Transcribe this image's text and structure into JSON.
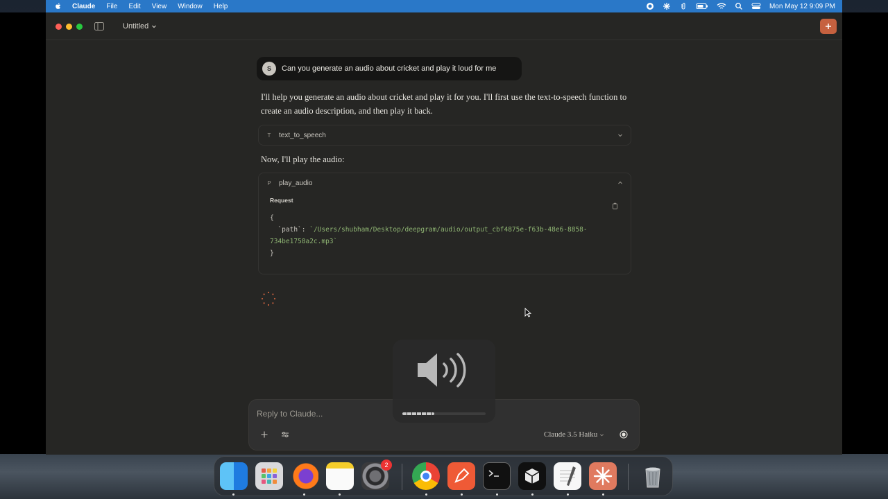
{
  "menubar": {
    "app": "Claude",
    "menus": [
      "File",
      "Edit",
      "View",
      "Window",
      "Help"
    ],
    "clock": "Mon May 12  9:09 PM"
  },
  "window": {
    "title": "Untitled"
  },
  "chat": {
    "user": {
      "initial": "S",
      "text": "Can you generate an audio about cricket and play it loud for me"
    },
    "assistant_intro": "I'll help you generate an audio about cricket and play it for you. I'll first use the text-to-speech function to create an audio description, and then play it back.",
    "tool1": {
      "letter": "T",
      "name": "text_to_speech",
      "expanded": false
    },
    "assistant_mid": "Now, I'll play the audio:",
    "tool2": {
      "letter": "P",
      "name": "play_audio",
      "expanded": true,
      "request_label": "Request",
      "code_open": "{",
      "code_key": "`path`",
      "code_colon": ": ",
      "code_value_line1": "`/Users/shubham/Desktop/deepgram/audio/output_cbf4875e-f63b-48e6-8858-",
      "code_value_line2": "734be1758a2c.mp3`",
      "code_close": "}"
    }
  },
  "composer": {
    "placeholder": "Reply to Claude...",
    "model": "Claude 3.5 Haiku"
  },
  "volume_hud": {
    "level": 0.38
  },
  "dock": {
    "apps": [
      "finder",
      "launchpad",
      "firefox",
      "notes",
      "system-settings",
      "chrome",
      "pen-app",
      "terminal",
      "cube-app",
      "textedit",
      "claude",
      "trash"
    ],
    "settings_badge": "2"
  },
  "colors": {
    "accent": "#c6613f",
    "menubar": "#2a78c8",
    "window_bg": "#262624"
  }
}
